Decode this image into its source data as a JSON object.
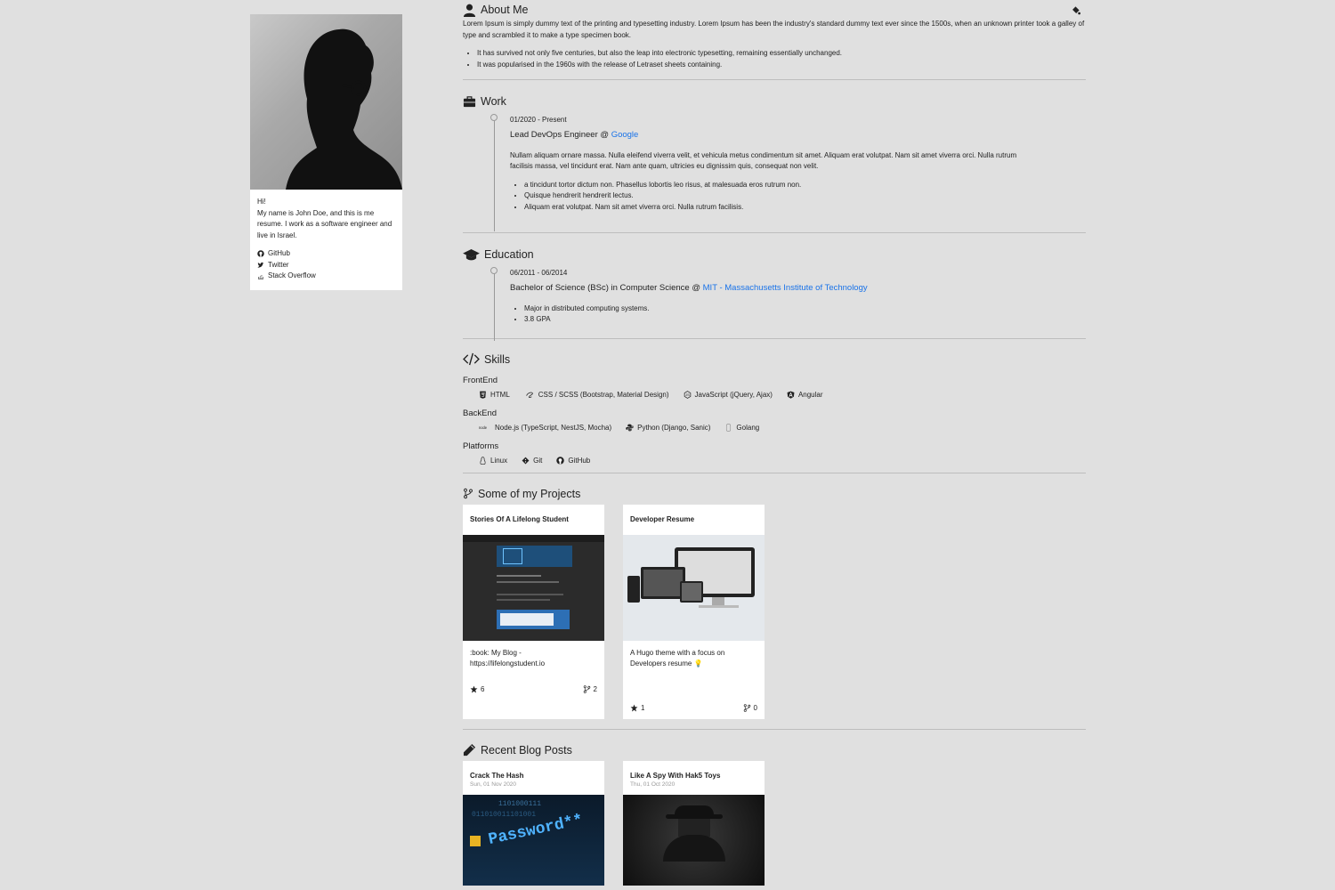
{
  "sidebar": {
    "greeting": "Hi!",
    "intro": "My name is John Doe, and this is me resume. I work as a software engineer and live in Israel.",
    "links": [
      {
        "label": "GitHub",
        "icon": "github-icon"
      },
      {
        "label": "Twitter",
        "icon": "twitter-icon"
      },
      {
        "label": "Stack Overflow",
        "icon": "stackoverflow-icon"
      }
    ]
  },
  "about": {
    "title": "About Me",
    "text": "Lorem Ipsum is simply dummy text of the printing and typesetting industry. Lorem Ipsum has been the industry's standard dummy text ever since the 1500s, when an unknown printer took a galley of type and scrambled it to make a type specimen book.",
    "bullets": [
      "It has survived not only five centuries, but also the leap into electronic typesetting, remaining essentially unchanged.",
      "It was popularised in the 1960s with the release of Letraset sheets containing."
    ]
  },
  "work": {
    "title": "Work",
    "date": "01/2020 - Present",
    "role": "Lead DevOps Engineer @ ",
    "company": "Google",
    "description": "Nullam aliquam ornare massa. Nulla eleifend viverra velit, et vehicula metus condimentum sit amet. Aliquam erat volutpat. Nam sit amet viverra orci. Nulla rutrum facilisis massa, vel tincidunt erat. Nam ante quam, ultricies eu dignissim quis, consequat non velit.",
    "bullets": [
      "a tincidunt tortor dictum non. Phasellus lobortis leo risus, at malesuada eros rutrum non.",
      "Quisque hendrerit hendrerit lectus.",
      "Aliquam erat volutpat. Nam sit amet viverra orci. Nulla rutrum facilisis."
    ]
  },
  "education": {
    "title": "Education",
    "date": "06/2011 - 06/2014",
    "degree": "Bachelor of Science (BSc) in Computer Science @ ",
    "school": "MIT - Massachusetts Institute of Technology",
    "bullets": [
      "Major in distributed computing systems.",
      "3.8 GPA"
    ]
  },
  "skills": {
    "title": "Skills",
    "frontend": {
      "label": "FrontEnd",
      "items": [
        "HTML",
        "CSS / SCSS (Bootstrap, Material Design)",
        "JavaScript (jQuery, Ajax)",
        "Angular"
      ]
    },
    "backend": {
      "label": "BackEnd",
      "items": [
        "Node.js (TypeScript, NestJS, Mocha)",
        "Python (Django, Sanic)",
        "Golang"
      ]
    },
    "platforms": {
      "label": "Platforms",
      "items": [
        "Linux",
        "Git",
        "GitHub"
      ]
    }
  },
  "projects": {
    "title": "Some of my Projects",
    "cards": [
      {
        "title": "Stories Of A Lifelong Student",
        "description": ":book: My Blog - https://lifelongstudent.io",
        "stars": "6",
        "forks": "2"
      },
      {
        "title": "Developer Resume",
        "description": "A Hugo theme with a focus on Developers resume 💡",
        "stars": "1",
        "forks": "0"
      }
    ]
  },
  "blog": {
    "title": "Recent Blog Posts",
    "posts": [
      {
        "title": "Crack The Hash",
        "date": "Sun, 01 Nov 2020",
        "image_text": "Password**"
      },
      {
        "title": "Like A Spy With Hak5 Toys",
        "date": "Thu, 01 Oct 2020"
      }
    ]
  },
  "colors": {
    "background": "#e0e0e0",
    "link": "#1a73e8",
    "card": "#ffffff"
  }
}
